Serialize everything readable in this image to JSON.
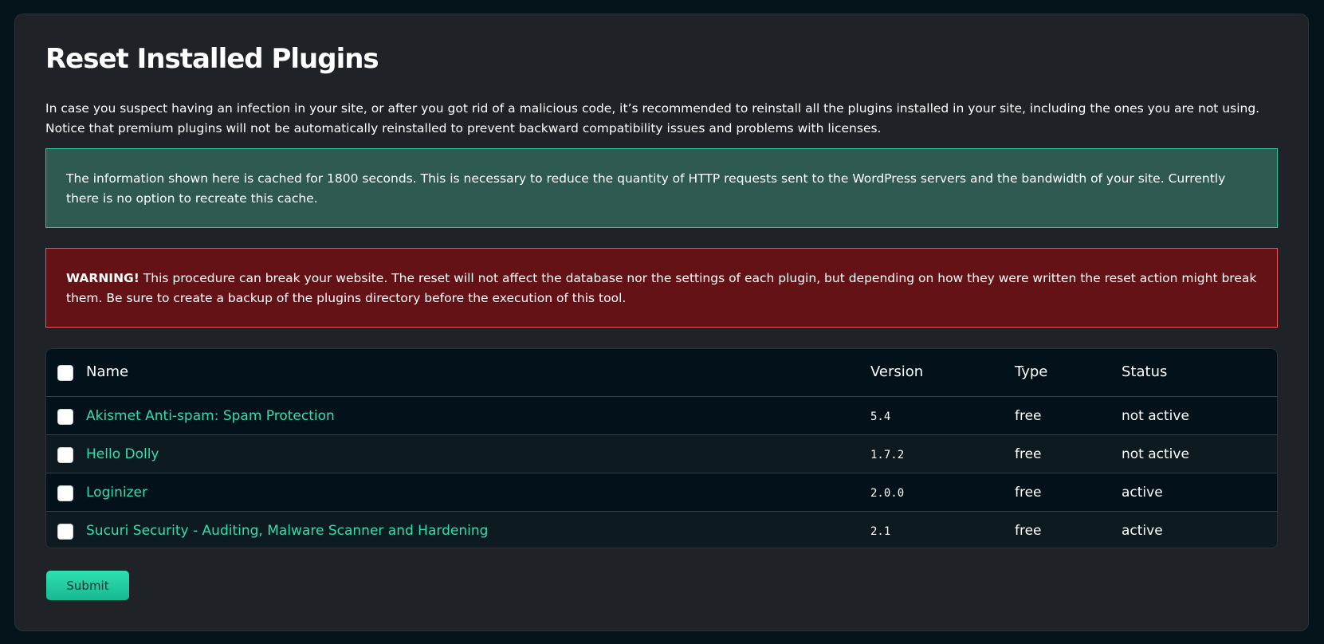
{
  "page": {
    "title": "Reset Installed Plugins",
    "intro": "In case you suspect having an infection in your site, or after you got rid of a malicious code, it’s recommended to reinstall all the plugins installed in your site, including the ones you are not using. Notice that premium plugins will not be automatically reinstalled to prevent backward compatibility issues and problems with licenses."
  },
  "notice": {
    "text": "The information shown here is cached for 1800 seconds. This is necessary to reduce the quantity of HTTP requests sent to the WordPress servers and the bandwidth of your site. Currently there is no option to recreate this cache."
  },
  "warning": {
    "label": "WARNING!",
    "text": " This procedure can break your website. The reset will not affect the database nor the settings of each plugin, but depending on how they were written the reset action might break them. Be sure to create a backup of the plugins directory before the execution of this tool."
  },
  "table": {
    "headers": {
      "name": "Name",
      "version": "Version",
      "type": "Type",
      "status": "Status"
    },
    "rows": [
      {
        "name": "Akismet Anti-spam: Spam Protection",
        "version": "5.4",
        "type": "free",
        "status": "not active"
      },
      {
        "name": "Hello Dolly",
        "version": "1.7.2",
        "type": "free",
        "status": "not active"
      },
      {
        "name": "Loginizer",
        "version": "2.0.0",
        "type": "free",
        "status": "active"
      },
      {
        "name": "Sucuri Security - Auditing, Malware Scanner and Hardening",
        "version": "2.1",
        "type": "free",
        "status": "active"
      }
    ]
  },
  "actions": {
    "submit_label": "Submit"
  },
  "colors": {
    "background": "#04141a",
    "panel": "#1f2327",
    "accent": "#2ee0b0",
    "notice_bg": "#2e5a51",
    "warning_bg": "#651216"
  }
}
